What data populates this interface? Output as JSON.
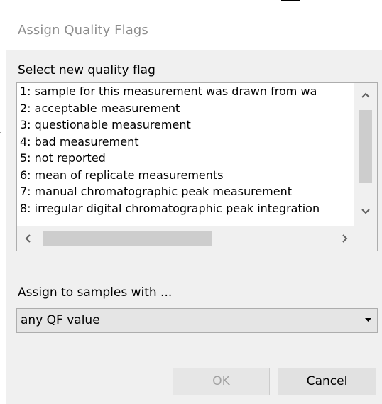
{
  "dialog": {
    "title": "Assign Quality Flags",
    "select_label": "Select new quality flag",
    "flags": [
      "1: sample for this measurement was drawn from wa",
      "2: acceptable measurement",
      "3: questionable measurement",
      "4: bad measurement",
      "5: not reported",
      "6: mean of replicate measurements",
      "7: manual chromatographic peak measurement",
      "8: irregular digital chromatographic peak integration"
    ],
    "assign_label": "Assign to samples with ...",
    "assign_value": "any QF value",
    "ok_label": "OK",
    "cancel_label": "Cancel"
  },
  "icons": {
    "scroll_up": "chevron-up-icon",
    "scroll_down": "chevron-down-icon",
    "scroll_left": "chevron-left-icon",
    "scroll_right": "chevron-right-icon",
    "dropdown": "dropdown-arrow-icon"
  },
  "colors": {
    "dialog_bg": "#f0f0f0",
    "title_text": "#8c8c8c",
    "disabled_text": "#a0a0a0"
  }
}
